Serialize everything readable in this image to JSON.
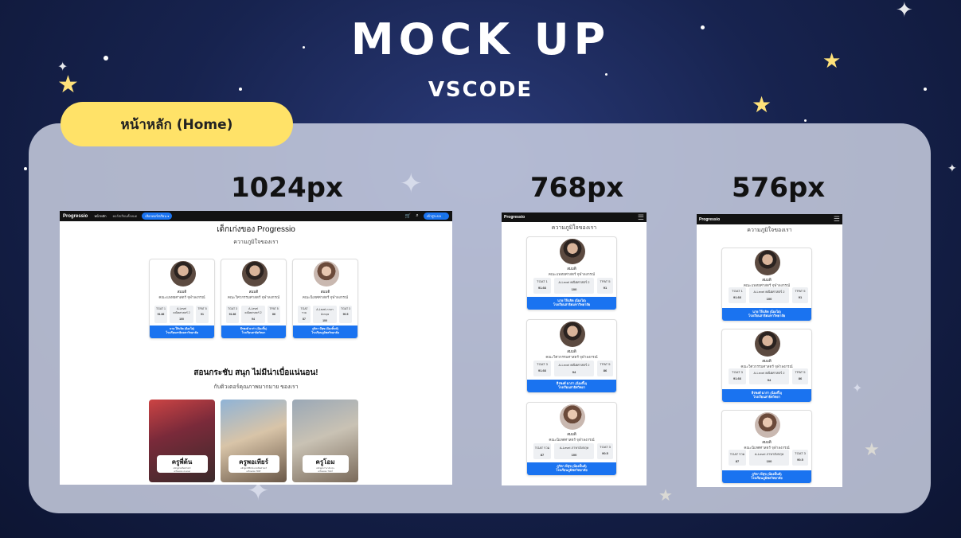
{
  "header": {
    "title": "MOCK UP",
    "subtitle": "VSCODE"
  },
  "section_label": "หน้าหลัก (Home)",
  "breakpoints": [
    "1024px",
    "768px",
    "576px"
  ],
  "site": {
    "brand": "Progressio",
    "nav_home": "หน้าหลัก",
    "nav_courses": "คอร์สเรียนทั้งหมด",
    "nav_select": "เลือกคอร์สเรียน",
    "nav_login": "เข้าสู่ระบบ",
    "hero_title": "เด็กเก่งของ Progressio",
    "hero_subtitle": "ความภูมิใจของเรา",
    "tutor_title": "สอนกระชับ สนุก ไม่มีน่าเบื่อแน่นอน!",
    "tutor_subtitle": "กับติวเตอร์คุณภาพมากมาย ของเรา"
  },
  "students": [
    {
      "name": "สมมติ",
      "faculty": "คณะแพทยศาสตร์ จุฬาลงกรณ์",
      "scores": [
        {
          "label": "TGAT 1",
          "value": "91.66"
        },
        {
          "label": "A-Level คณิตศาสตร์ 2",
          "value": "100"
        },
        {
          "label": "TPAT 5",
          "value": "91"
        }
      ],
      "button": "นาย ใจ้นจิต (น้องไผ่)\nโรงเรียนสาธิตมหาวิทยาลัย"
    },
    {
      "name": "สมมติ",
      "faculty": "คณะวิศวกรรมศาสตร์ จุฬาลงกรณ์",
      "scores": [
        {
          "label": "TGAT 3",
          "value": "91.66"
        },
        {
          "label": "A-Level คณิตศาสตร์ 2",
          "value": "94"
        },
        {
          "label": "TPAT 5",
          "value": "86"
        }
      ],
      "button": "ธีรพงศ์ ฉาก่า (น้องกิ๊บ)\nโรงเรียนสาธิตวิทยา"
    },
    {
      "name": "สมมติ",
      "faculty": "คณะนิเทศศาสตร์ จุฬาลงกรณ์",
      "scores": [
        {
          "label": "TGAT รวม",
          "value": "87"
        },
        {
          "label": "A-Level ภาษาอังกฤษ",
          "value": "100"
        },
        {
          "label": "TGAT 3",
          "value": "90.5"
        }
      ],
      "button": "ภูริตา มีสุข (น้องมิ้นท์)\nโรงเรียนภูมิพลวิทยาลัย"
    }
  ],
  "tutors": [
    {
      "name": "ครูพี่ต้น",
      "desc": "หลักสูตรคณิตศาสตร์\nเตรียมสอบ A-Level"
    },
    {
      "name": "ครูพอเทียร์",
      "desc": "หลักสูตรฟิสิกส์และคณิตศาสตร์\nเตรียมสอบ TPAT"
    },
    {
      "name": "ครูโอม",
      "desc": "หลักสูตรภาษาอังกฤษ\nเตรียมสอบ TGAT"
    }
  ],
  "colors": {
    "accent": "#1a73f0",
    "pill": "#ffe268",
    "nav": "#121212"
  }
}
